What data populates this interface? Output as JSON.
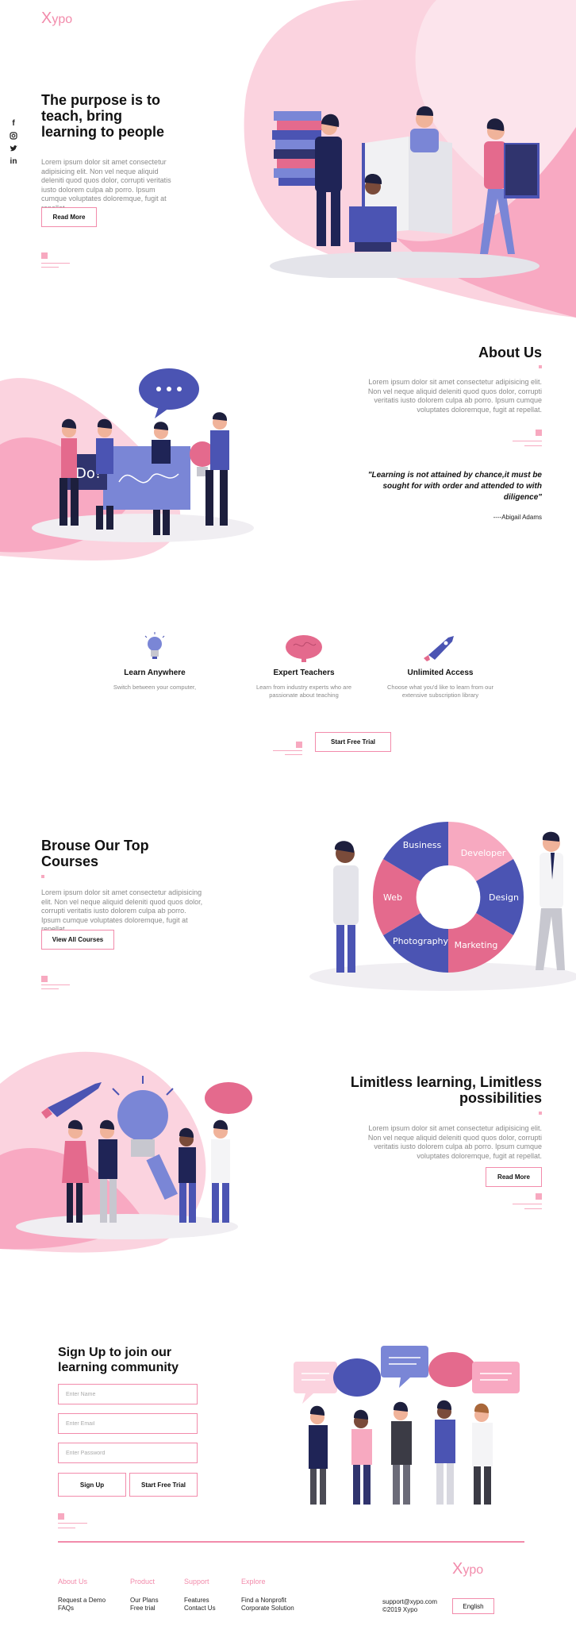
{
  "brand": {
    "logo_x": "X",
    "logo_rest": "ypo",
    "accent": "#f28bab"
  },
  "social": [
    "facebook-icon",
    "instagram-icon",
    "twitter-icon",
    "linkedin-icon"
  ],
  "hero": {
    "title": "The purpose is to teach, bring learning to people",
    "text": "Lorem ipsum dolor sit amet consectetur adipisicing elit. Non vel neque aliquid deleniti quod quos dolor, corrupti veritatis iusto dolorem culpa ab porro. Ipsum cumque voluptates doloremque, fugit at repellat.",
    "button": "Read More"
  },
  "about": {
    "title": "About Us",
    "text": "Lorem ipsum dolor sit amet consectetur adipisicing elit. Non vel neque aliquid deleniti quod quos dolor, corrupti veritatis iusto dolorem culpa ab porro. Ipsum cumque voluptates doloremque, fugit at repellat.",
    "quote": "\"Learning is not attained by chance,it must be sought for with order and attended to with diligence\"",
    "author": "----Abigail Adams",
    "board_text": "Do!"
  },
  "features": [
    {
      "title": "Learn Anywhere",
      "text": "Switch between your computer,"
    },
    {
      "title": "Expert Teachers",
      "text": "Learn from industry experts who are passionate about teaching"
    },
    {
      "title": "Unlimited Access",
      "text": "Choose what you'd like to learn from our extensive subscription library"
    }
  ],
  "trial_button": "Start Free Trial",
  "courses": {
    "title": "Brouse Our Top Courses",
    "text": "Lorem ipsum dolor sit amet consectetur adipisicing elit. Non vel neque aliquid deleniti quod quos dolor, corrupti veritatis iusto dolorem culpa ab porro. Ipsum cumque voluptates doloremque, fugit at repellat.",
    "button": "View All Courses",
    "wheel": [
      "Business",
      "Developer",
      "Design",
      "Marketing",
      "Photography",
      "Web"
    ]
  },
  "limitless": {
    "title": "Limitless learning, Limitless possibilities",
    "text": "Lorem ipsum dolor sit amet consectetur adipisicing elit. Non vel neque aliquid deleniti quod quos dolor, corrupti veritatis iusto dolorem culpa ab porro. Ipsum cumque voluptates doloremque, fugit at repellat.",
    "button": "Read More"
  },
  "signup": {
    "title": "Sign Up to join our learning community",
    "name_placeholder": "Enter Name",
    "email_placeholder": "Enter Email",
    "password_placeholder": "Enter Password",
    "signup_button": "Sign Up",
    "trial_button": "Start Free Trial"
  },
  "footer": {
    "columns": [
      {
        "head": "About Us",
        "links": [
          "Request a Demo",
          "FAQs"
        ]
      },
      {
        "head": "Product",
        "links": [
          "Our Plans",
          "Free trial"
        ]
      },
      {
        "head": "Support",
        "links": [
          "Features",
          "Contact Us"
        ]
      },
      {
        "head": "Explore",
        "links": [
          "Find a Nonprofit",
          "Corporate Solution"
        ]
      }
    ],
    "email": "support@xypo.com",
    "copyright": "©2019 Xypo",
    "language": "English"
  }
}
